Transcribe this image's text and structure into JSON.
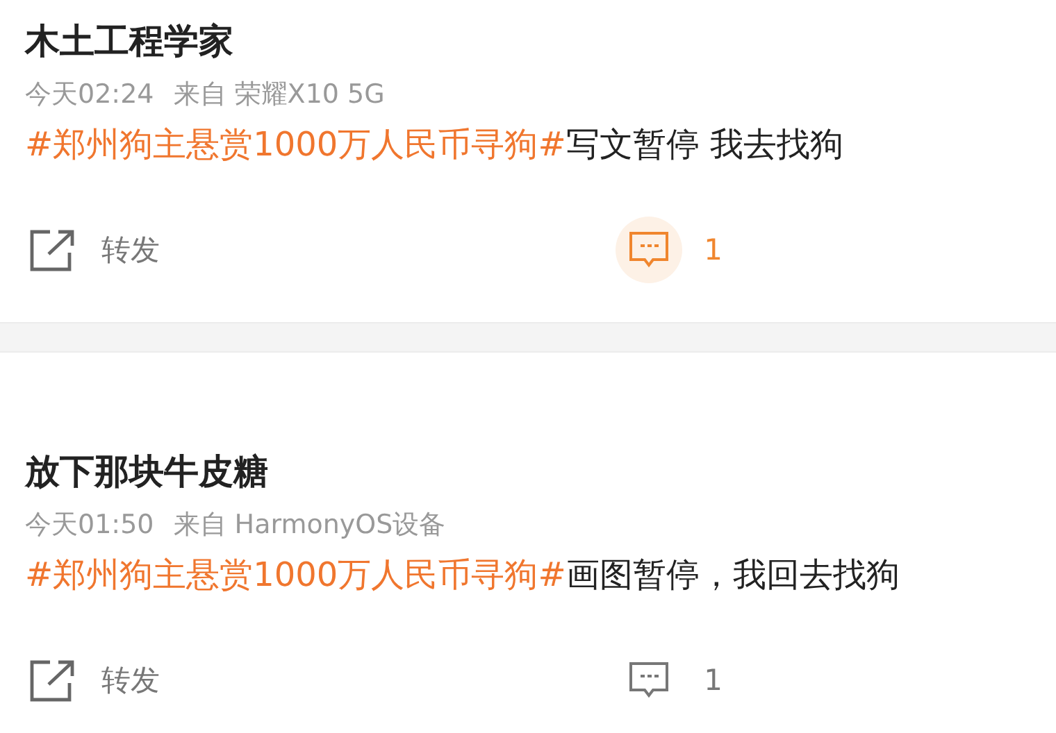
{
  "posts": [
    {
      "author": "木土工程学家",
      "time": "今天02:24",
      "source": "来自 荣耀X10 5G",
      "hashtag": "#郑州狗主悬赏1000万人民币寻狗#",
      "text": "写文暂停 我去找狗",
      "repost_label": "转发",
      "comment_count": "1",
      "comment_active": true
    },
    {
      "author": "放下那块牛皮糖",
      "time": "今天01:50",
      "source": "来自 HarmonyOS设备",
      "hashtag": "#郑州狗主悬赏1000万人民币寻狗#",
      "text": "画图暂停，我回去找狗",
      "repost_label": "转发",
      "comment_count": "1",
      "comment_active": false
    }
  ]
}
